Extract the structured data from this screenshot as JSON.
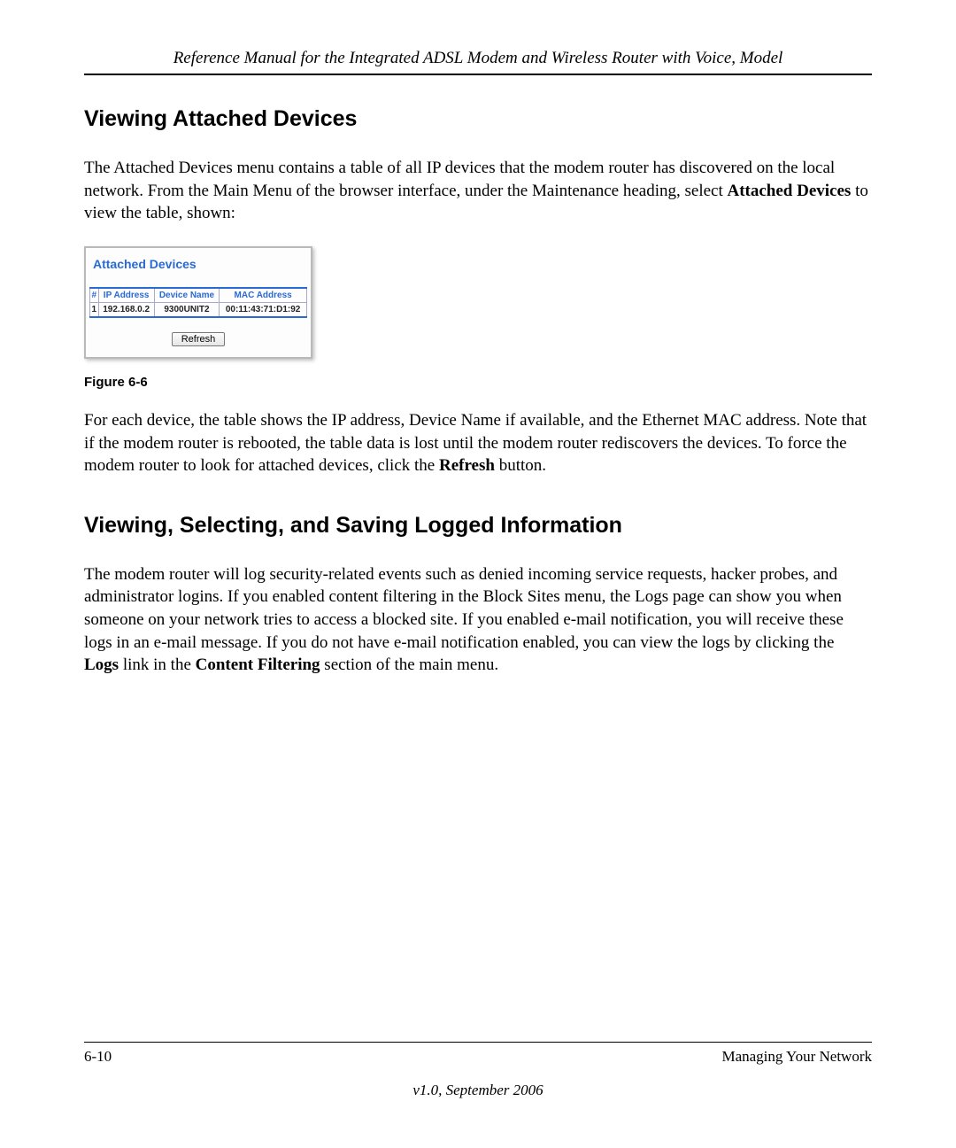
{
  "header": {
    "title": "Reference Manual for the Integrated ADSL Modem and Wireless Router with Voice, Model"
  },
  "section1": {
    "heading": "Viewing Attached Devices",
    "para1_part1": "The Attached Devices menu contains a table of all IP devices that the modem router has discovered on the local network. From the Main Menu of the browser interface, under the Maintenance heading, select ",
    "para1_bold": "Attached Devices",
    "para1_part2": " to view the table, shown:"
  },
  "figure": {
    "panel_title": "Attached Devices",
    "columns": {
      "num": "#",
      "ip": "IP Address",
      "name": "Device Name",
      "mac": "MAC Address"
    },
    "rows": [
      {
        "num": "1",
        "ip": "192.168.0.2",
        "name": "9300UNIT2",
        "mac": "00:11:43:71:D1:92"
      }
    ],
    "refresh_label": "Refresh",
    "caption": "Figure 6-6"
  },
  "para2": {
    "part1": "For each device, the table shows the IP address, Device Name if available, and the Ethernet MAC address. Note that if the modem router is rebooted, the table data is lost until the modem router rediscovers the devices. To force the modem router to look for attached devices, click the ",
    "bold": "Refresh",
    "part2": " button."
  },
  "section2": {
    "heading": "Viewing, Selecting, and Saving Logged Information",
    "para_part1": "The modem router will log security-related events such as denied incoming service requests, hacker probes, and administrator logins. If you enabled content filtering in the Block Sites menu, the Logs page can show you when someone on your network tries to access a blocked site. If you enabled e-mail notification, you will receive these logs in an e-mail message. If you do not have e-mail notification enabled, you can view the logs by clicking the ",
    "bold1": "Logs",
    "para_mid": " link in the ",
    "bold2": "Content Filtering",
    "para_part2": " section of the main menu."
  },
  "footer": {
    "page": "6-10",
    "section": "Managing Your Network",
    "version": "v1.0, September 2006"
  }
}
